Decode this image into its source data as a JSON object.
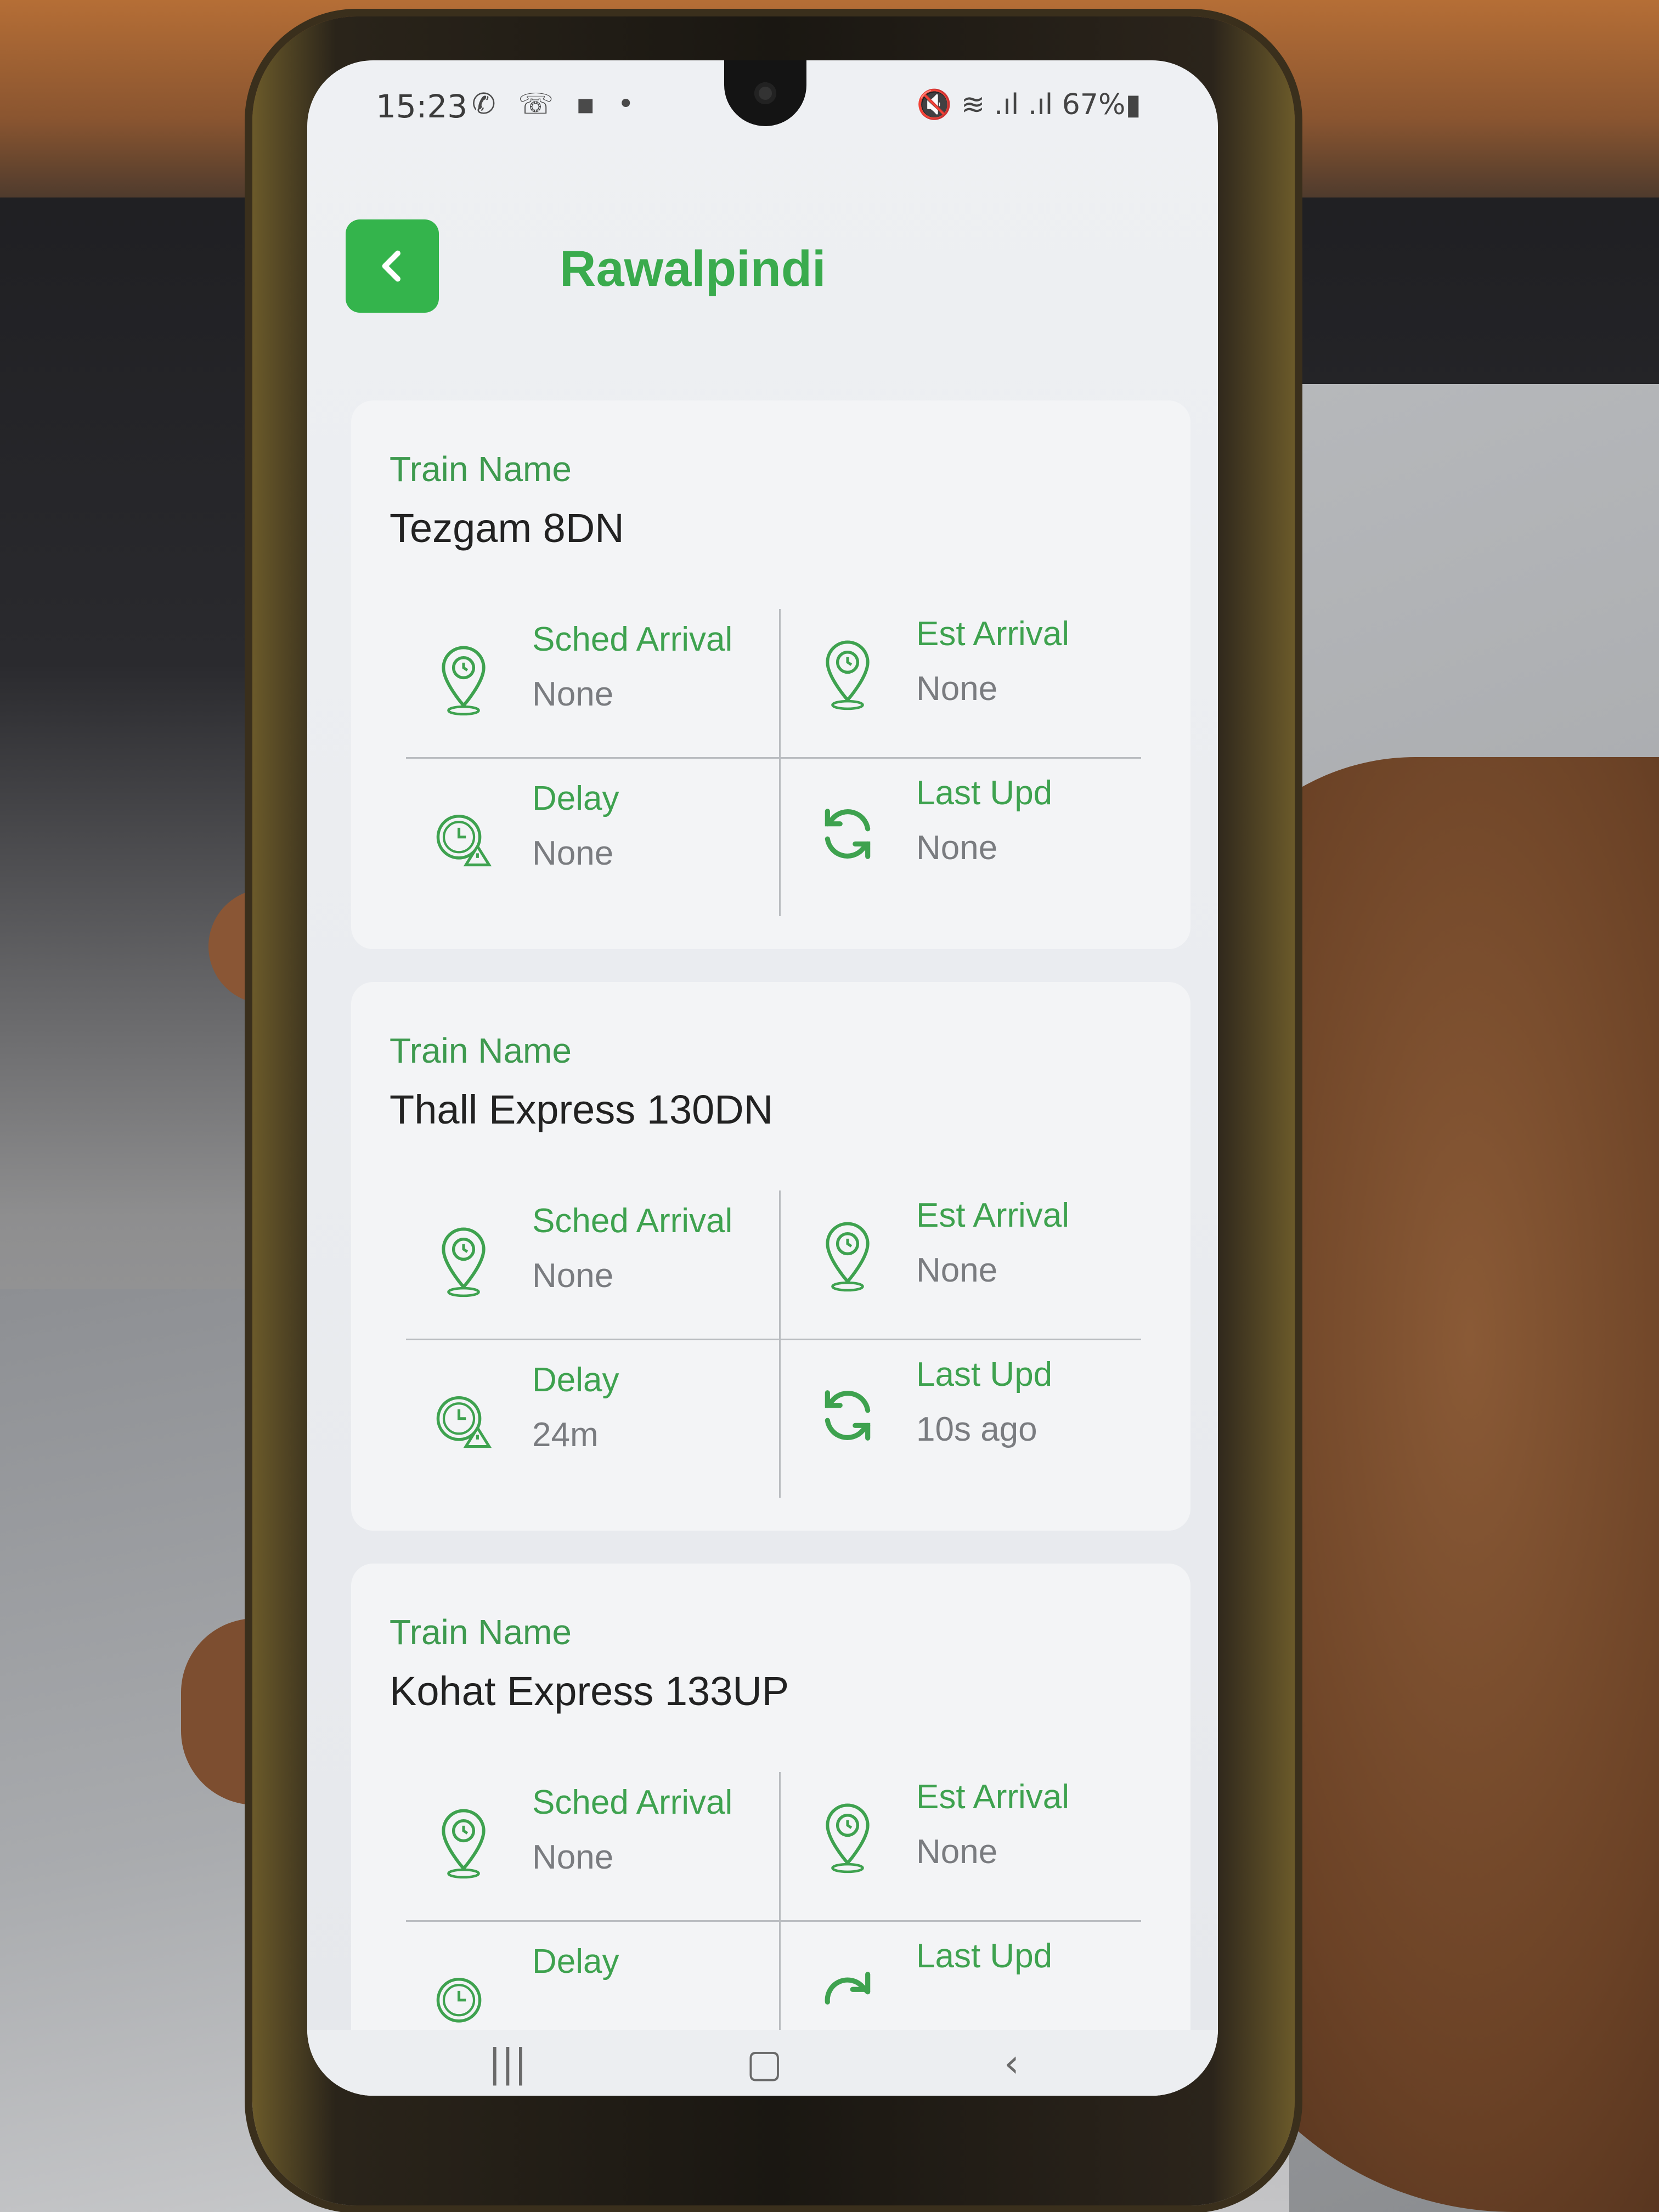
{
  "status_bar": {
    "time": "15:23",
    "left_icons": "✆ ☏ ▪ •",
    "right_icons": "🔇 ≋ .ıl .ıl",
    "battery": "67%▮"
  },
  "header": {
    "title": "Rawalpindi",
    "back_icon": "chevron-left-icon"
  },
  "cards": [
    {
      "label": "Train Name",
      "name": "Tezgam 8DN",
      "sched_label": "Sched Arrival",
      "sched_value": "None",
      "est_label": "Est Arrival",
      "est_value": "None",
      "delay_label": "Delay",
      "delay_value": "None",
      "last_label": "Last Upd",
      "last_value": "None"
    },
    {
      "label": "Train Name",
      "name": "Thall Express 130DN",
      "sched_label": "Sched Arrival",
      "sched_value": "None",
      "est_label": "Est Arrival",
      "est_value": "None",
      "delay_label": "Delay",
      "delay_value": "24m",
      "last_label": "Last Upd",
      "last_value": "10s ago"
    },
    {
      "label": "Train Name",
      "name": "Kohat Express 133UP",
      "sched_label": "Sched Arrival",
      "sched_value": "None",
      "est_label": "Est Arrival",
      "est_value": "None",
      "delay_label": "Delay",
      "delay_value": "",
      "last_label": "Last Upd",
      "last_value": ""
    }
  ],
  "nav": {
    "recents": "|||",
    "home": "▢",
    "back": "‹"
  },
  "colors": {
    "accent": "#3aab4d",
    "button": "#34b44c",
    "muted_text": "#7a7c80"
  }
}
